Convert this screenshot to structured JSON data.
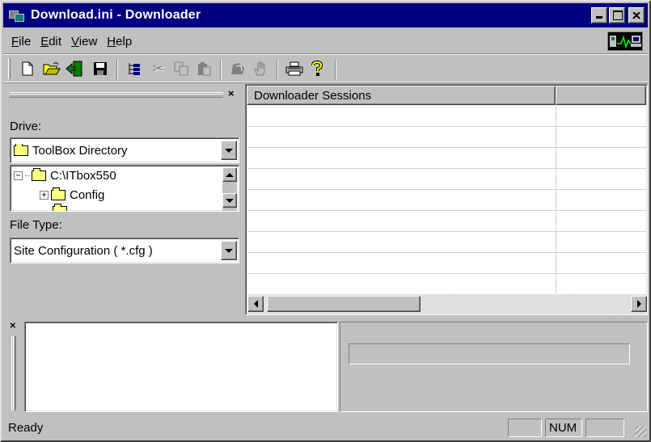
{
  "window": {
    "title": "Download.ini - Downloader"
  },
  "menu": {
    "items": [
      {
        "accel": "F",
        "rest": "ile"
      },
      {
        "accel": "E",
        "rest": "dit"
      },
      {
        "accel": "V",
        "rest": "iew"
      },
      {
        "accel": "H",
        "rest": "elp"
      }
    ]
  },
  "toolbar": {
    "icons": {
      "new": "🗋",
      "open": "📂",
      "exit": "◀",
      "save": "💾",
      "tree": "⊦",
      "cut": "✂",
      "copy": "⎘",
      "paste": "📋",
      "stamp": "▟",
      "hand": "✋",
      "print": "🖶",
      "help": "?"
    }
  },
  "left_pane": {
    "close_glyph": "×",
    "drive_label": "Drive:",
    "drive_value": "ToolBox Directory",
    "tree": {
      "root": "C:\\ITbox550",
      "child": "Config",
      "root_expander": "−",
      "child_expander": "+"
    },
    "filetype_label": "File Type:",
    "filetype_value": "Site Configuration ( *.cfg )"
  },
  "sessions": {
    "columns": [
      "Downloader Sessions",
      ""
    ]
  },
  "bottom": {
    "close_glyph": "×"
  },
  "status": {
    "text": "Ready",
    "cells": [
      "",
      "NUM",
      ""
    ]
  },
  "colors": {
    "titlebar": "#000080",
    "face": "#c0c0c0",
    "folder": "#ffff80"
  }
}
